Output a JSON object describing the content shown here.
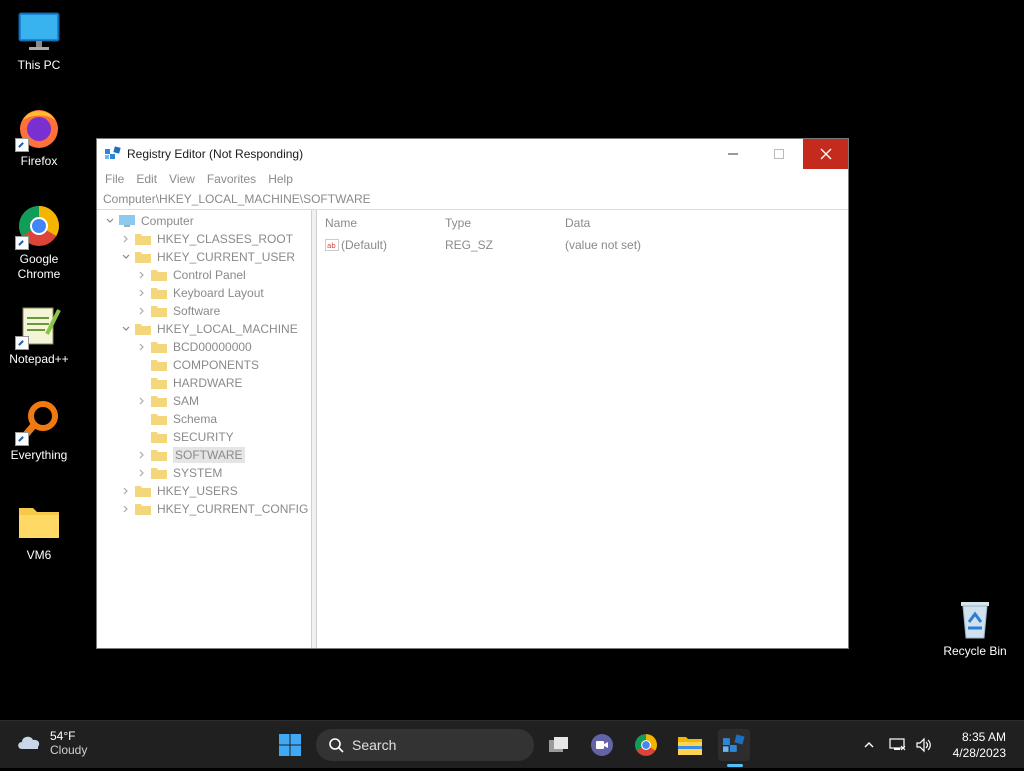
{
  "desktop": {
    "icons": [
      {
        "label": "This PC"
      },
      {
        "label": "Firefox"
      },
      {
        "label": "Google Chrome"
      },
      {
        "label": "Notepad++"
      },
      {
        "label": "Everything"
      },
      {
        "label": "VM6"
      },
      {
        "label": "Recycle Bin"
      }
    ]
  },
  "window": {
    "title": "Registry Editor (Not Responding)",
    "menu": [
      "File",
      "Edit",
      "View",
      "Favorites",
      "Help"
    ],
    "address": "Computer\\HKEY_LOCAL_MACHINE\\SOFTWARE",
    "tree": [
      {
        "label": "Computer"
      },
      {
        "label": "HKEY_CLASSES_ROOT"
      },
      {
        "label": "HKEY_CURRENT_USER"
      },
      {
        "label": "Control Panel"
      },
      {
        "label": "Keyboard Layout"
      },
      {
        "label": "Software"
      },
      {
        "label": "HKEY_LOCAL_MACHINE"
      },
      {
        "label": "BCD00000000"
      },
      {
        "label": "COMPONENTS"
      },
      {
        "label": "HARDWARE"
      },
      {
        "label": "SAM"
      },
      {
        "label": "Schema"
      },
      {
        "label": "SECURITY"
      },
      {
        "label": "SOFTWARE"
      },
      {
        "label": "SYSTEM"
      },
      {
        "label": "HKEY_USERS"
      },
      {
        "label": "HKEY_CURRENT_CONFIG"
      }
    ],
    "columns": {
      "name": "Name",
      "type": "Type",
      "data": "Data"
    },
    "values": [
      {
        "name": "(Default)",
        "type": "REG_SZ",
        "data": "(value not set)"
      }
    ]
  },
  "taskbar": {
    "weather_temp": "54°F",
    "weather_desc": "Cloudy",
    "search_label": "Search",
    "time": "8:35 AM",
    "date": "4/28/2023"
  },
  "colors": {
    "close_button": "#c42b1c",
    "taskbar": "#202020",
    "active_indicator": "#4cc2ff"
  }
}
